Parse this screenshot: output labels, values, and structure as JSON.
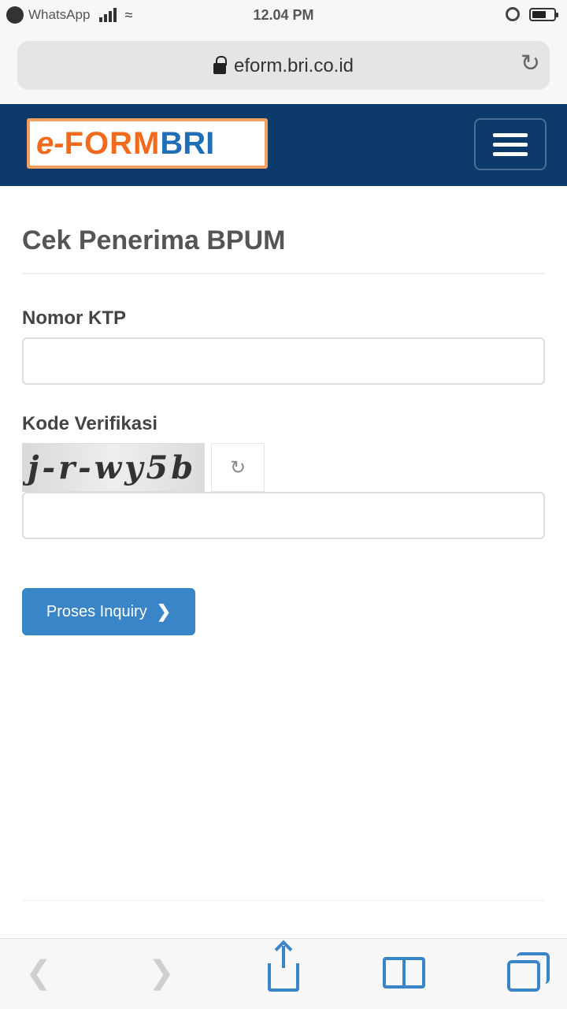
{
  "status_bar": {
    "back_app": "WhatsApp",
    "time": "12.04 PM"
  },
  "browser": {
    "url": "eform.bri.co.id",
    "reload_icon": "reload-icon"
  },
  "header": {
    "logo": {
      "e": "e-",
      "form": "FORM",
      "bri": "BRI"
    },
    "menu_icon": "hamburger-icon",
    "bg_color": "#0b3a6b"
  },
  "page": {
    "title": "Cek Penerima BPUM",
    "ktp": {
      "label": "Nomor KTP",
      "value": "",
      "placeholder": ""
    },
    "captcha": {
      "label": "Kode Verifikasi",
      "image_text": "j-r-wy5b",
      "refresh_icon": "refresh-icon",
      "value": "",
      "placeholder": ""
    },
    "submit": {
      "label": "Proses Inquiry",
      "icon": "chevron-right-icon",
      "color": "#3a85c8"
    }
  },
  "toolbar": {
    "back_icon": "back-icon",
    "forward_icon": "forward-icon",
    "share_icon": "share-icon",
    "bookmarks_icon": "bookmarks-icon",
    "tabs_icon": "tabs-icon"
  }
}
